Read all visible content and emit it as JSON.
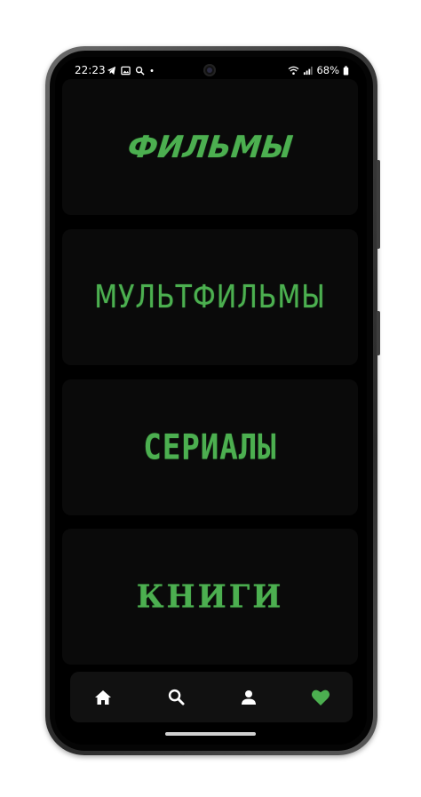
{
  "status_bar": {
    "time": "22:23",
    "left_icons": [
      "telegram-icon",
      "image-icon",
      "search-icon",
      "dot-icon"
    ],
    "right_icons": [
      "wifi-icon",
      "signal-icon",
      "battery-icon"
    ],
    "battery": "68%"
  },
  "categories": [
    {
      "label": "ФИЛЬМЫ"
    },
    {
      "label": "МУЛЬТФИЛЬМЫ"
    },
    {
      "label": "СЕРИАЛЫ"
    },
    {
      "label": "КНИГИ"
    }
  ],
  "bottom_nav": {
    "items": [
      {
        "icon": "home-icon",
        "active": false
      },
      {
        "icon": "search-icon",
        "active": false
      },
      {
        "icon": "profile-icon",
        "active": false
      },
      {
        "icon": "heart-icon",
        "active": true
      }
    ]
  },
  "colors": {
    "accent_green": "#4caf50",
    "background": "#000000",
    "card": "#0a0a0a",
    "nav_bar": "#111111",
    "icon_white": "#ffffff"
  }
}
